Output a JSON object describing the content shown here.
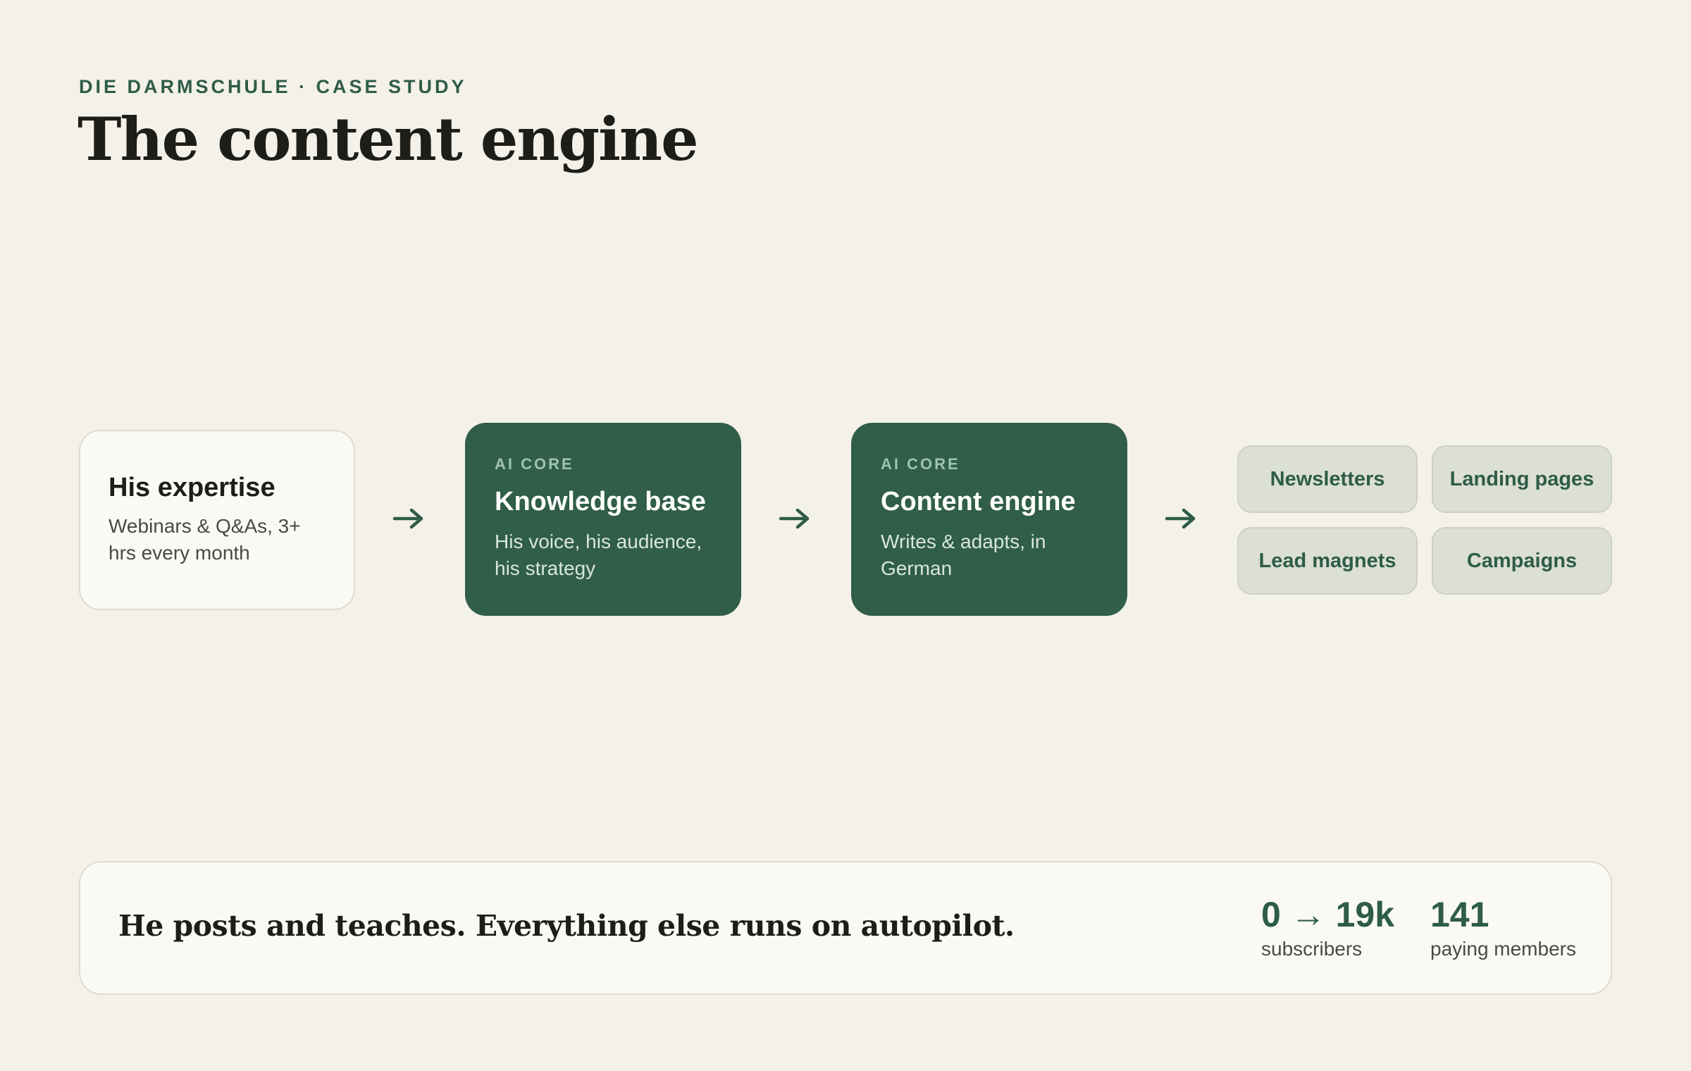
{
  "header": {
    "eyebrow": "DIE DARMSCHULE · CASE STUDY",
    "title": "The content engine"
  },
  "flow": {
    "input": {
      "title": "His expertise",
      "subtitle": "Webinars & Q&As, 3+ hrs every month"
    },
    "knowledge_base": {
      "tag": "AI CORE",
      "title": "Knowledge base",
      "subtitle": "His voice, his audience, his strategy"
    },
    "content_engine": {
      "tag": "AI CORE",
      "title": "Content engine",
      "subtitle": "Writes & adapts, in German"
    },
    "outputs": [
      "Newsletters",
      "Landing pages",
      "Lead magnets",
      "Campaigns"
    ],
    "arrow_icon": "arrow-right-icon"
  },
  "summary": {
    "text": "He posts and teaches. Everything else runs on autopilot.",
    "stats": [
      {
        "value": "0 → 19k",
        "label": "subscribers"
      },
      {
        "value": "141",
        "label": "paying members"
      }
    ]
  },
  "colors": {
    "background": "#f4f1e9",
    "accent": "#305e48",
    "card_light": "#faf9f4",
    "chip": "#dcdfd4"
  }
}
